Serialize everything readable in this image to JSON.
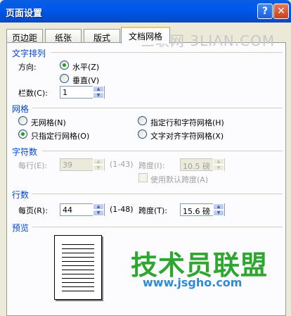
{
  "window": {
    "title": "页面设置",
    "help_glyph": "?",
    "close_glyph": "✕"
  },
  "tabs": [
    {
      "label": "页边距"
    },
    {
      "label": "纸张"
    },
    {
      "label": "版式"
    },
    {
      "label": "文档网格"
    }
  ],
  "text_layout": {
    "group_label": "文字排列",
    "direction_label": "方向:",
    "horizontal": "水平(Z)",
    "vertical": "垂直(V)",
    "columns_label": "栏数(C):",
    "columns_value": "1"
  },
  "grid": {
    "group_label": "网格",
    "no_grid": "无网格(N)",
    "line_grid_only": "只指定行网格(O)",
    "line_and_char_grid": "指定行和字符网格(H)",
    "snap_to_char_grid": "文字对齐字符网格(X)"
  },
  "characters": {
    "group_label": "字符数",
    "per_line_label": "每行(E):",
    "per_line_value": "39",
    "per_line_range": "(1-43)",
    "pitch_label": "跨度(I):",
    "pitch_value": "10.5 磅",
    "use_default_pitch": "使用默认跨度(A)"
  },
  "lines": {
    "group_label": "行数",
    "per_page_label": "每页(R):",
    "per_page_value": "44",
    "per_page_range": "(1-48)",
    "pitch_label": "跨度(T):",
    "pitch_value": "15.6 磅"
  },
  "preview": {
    "group_label": "预览"
  },
  "watermarks": {
    "top": "三联网 3LIAN.COM",
    "brand": "技术员联盟",
    "url": "www.jsgho.com"
  },
  "colors": {
    "titlebar": "#0058ee",
    "group_label": "#0046d5",
    "active_tab_accent": "#ffc83c"
  }
}
